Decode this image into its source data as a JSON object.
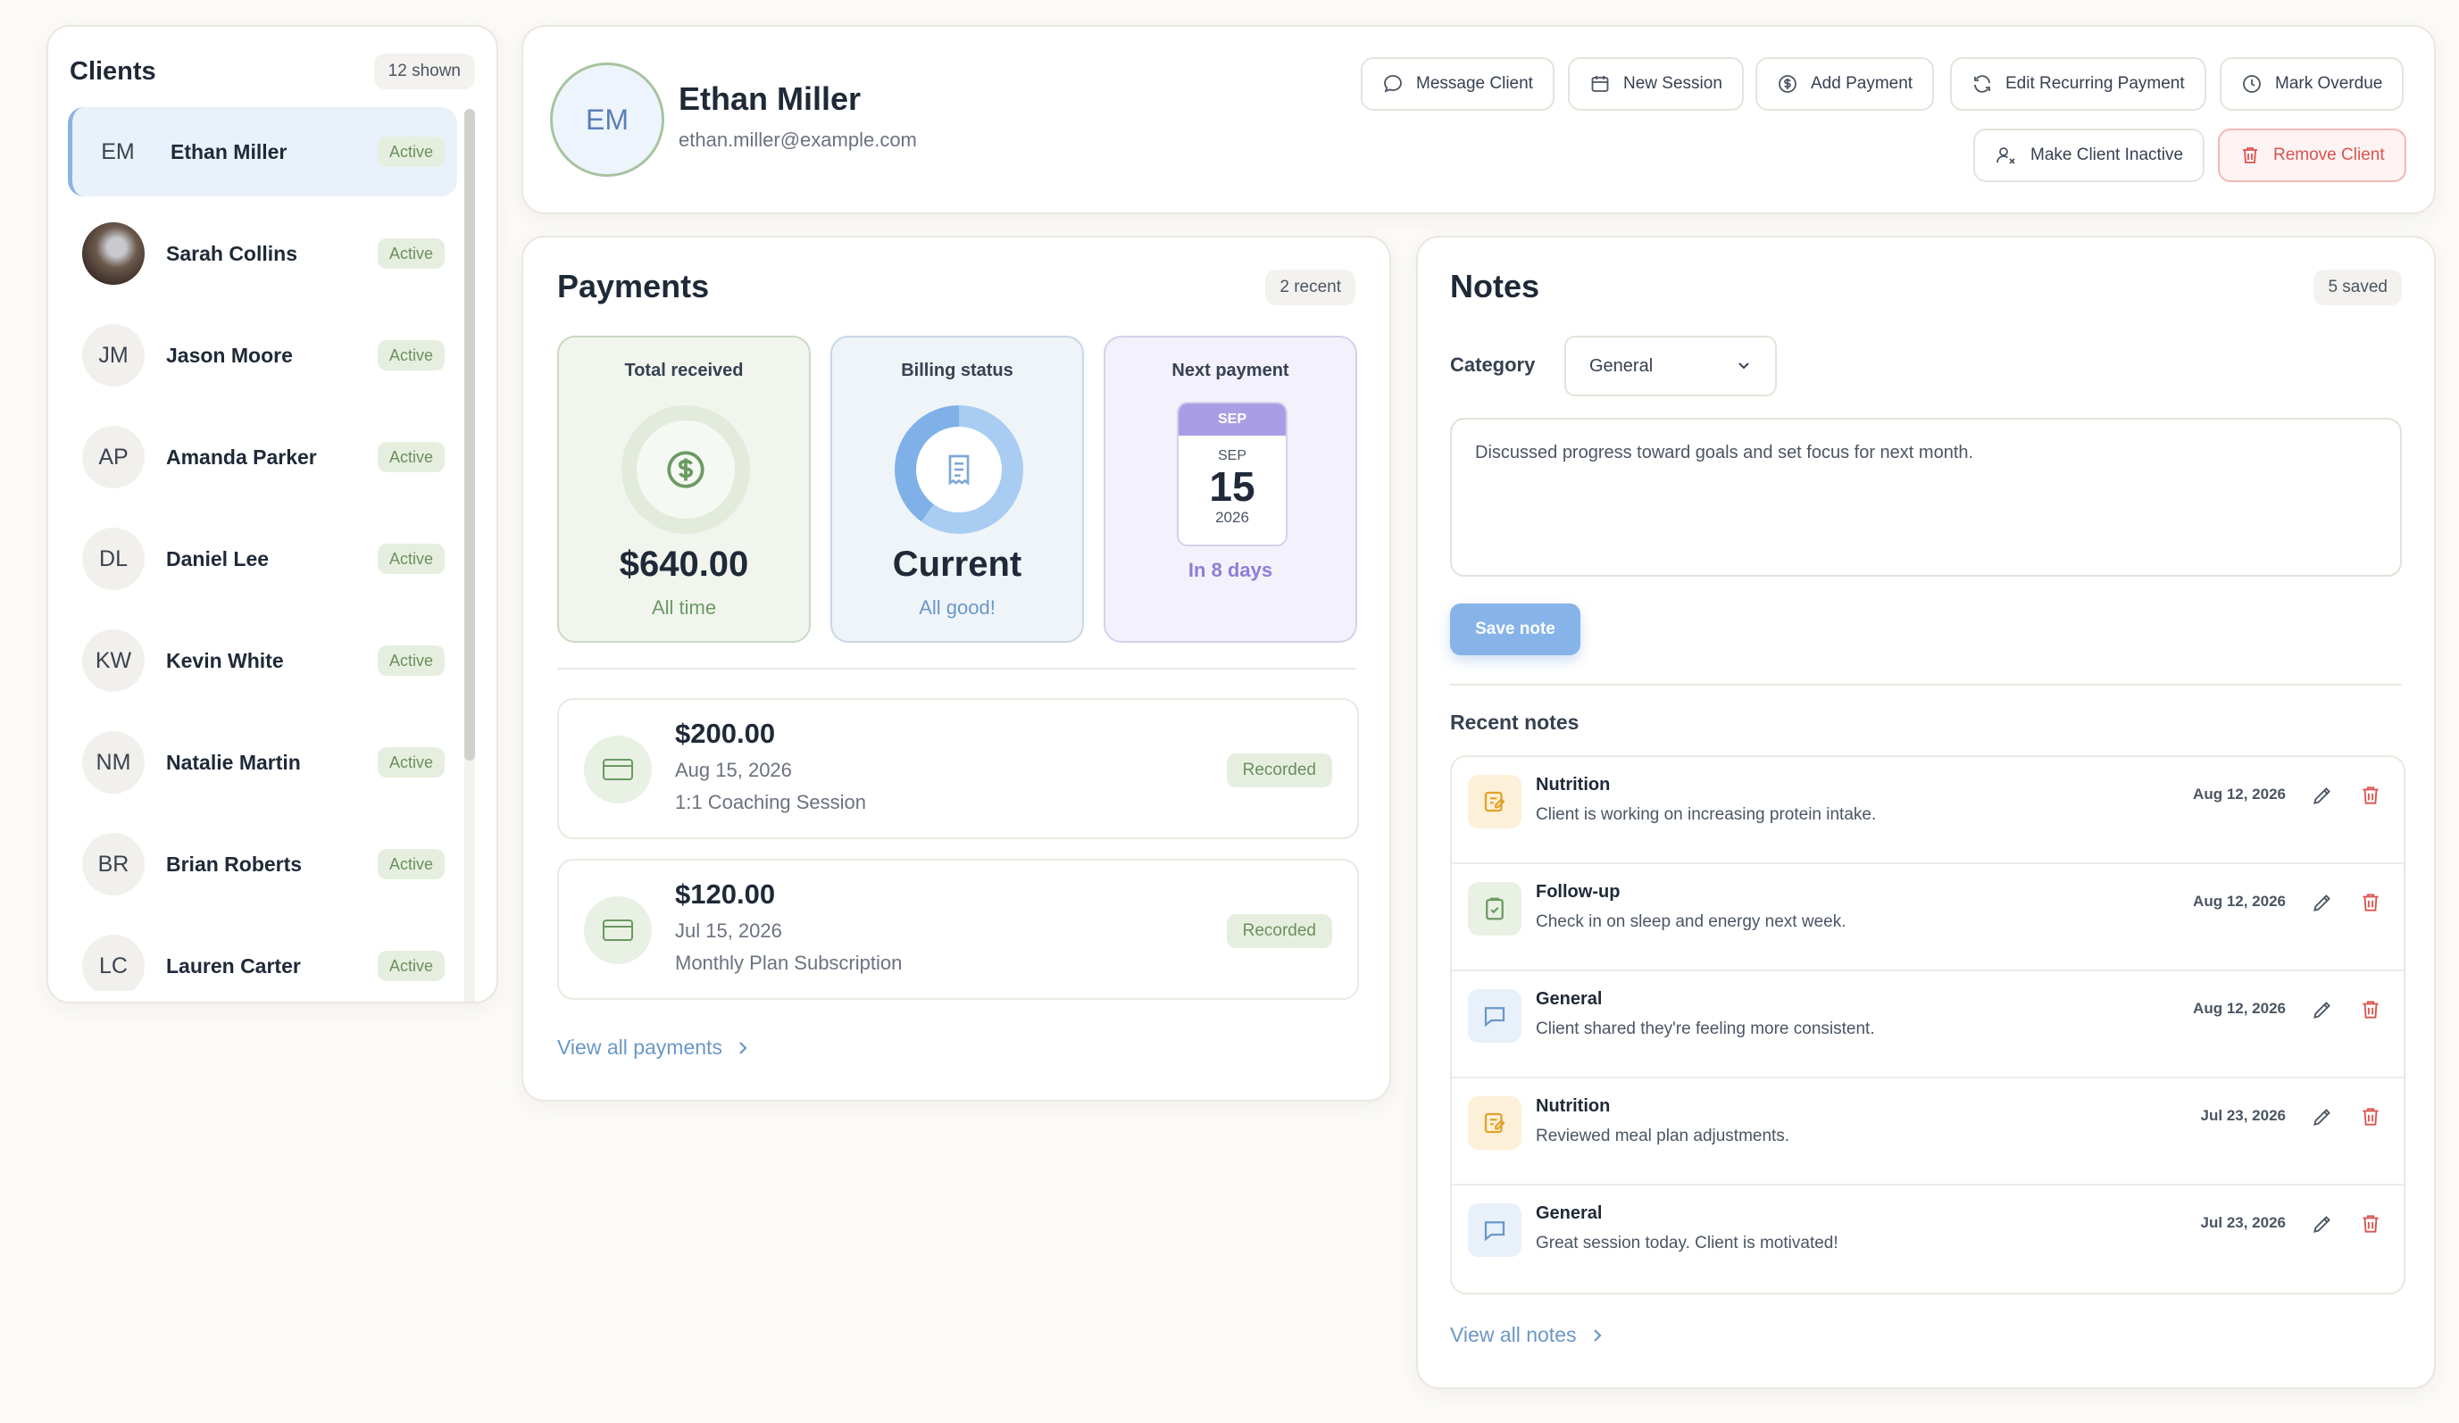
{
  "clients": {
    "title": "Clients",
    "count": "12 shown",
    "items": [
      {
        "initials": "EM",
        "name": "Ethan Miller",
        "status": "Active",
        "selected": true,
        "photo": false
      },
      {
        "initials": "",
        "name": "Sarah Collins",
        "status": "Active",
        "selected": false,
        "photo": true
      },
      {
        "initials": "JM",
        "name": "Jason Moore",
        "status": "Active",
        "selected": false,
        "photo": false
      },
      {
        "initials": "AP",
        "name": "Amanda Parker",
        "status": "Active",
        "selected": false,
        "photo": false
      },
      {
        "initials": "DL",
        "name": "Daniel Lee",
        "status": "Active",
        "selected": false,
        "photo": false
      },
      {
        "initials": "KW",
        "name": "Kevin White",
        "status": "Active",
        "selected": false,
        "photo": false
      },
      {
        "initials": "NM",
        "name": "Natalie Martin",
        "status": "Active",
        "selected": false,
        "photo": false
      },
      {
        "initials": "BR",
        "name": "Brian Roberts",
        "status": "Active",
        "selected": false,
        "photo": false
      },
      {
        "initials": "LC",
        "name": "Lauren Carter",
        "status": "Active",
        "selected": false,
        "photo": false
      }
    ]
  },
  "profile": {
    "initials": "EM",
    "name": "Ethan Miller",
    "email": "ethan.miller@example.com",
    "actions": {
      "message": "Message Client",
      "new_session": "New Session",
      "add_payment": "Add Payment",
      "edit_recurring": "Edit Recurring Payment",
      "mark_overdue": "Mark Overdue",
      "make_inactive": "Make Client Inactive",
      "remove": "Remove Client"
    }
  },
  "payments": {
    "title": "Payments",
    "count": "2 recent",
    "total": {
      "label": "Total received",
      "value": "$640.00",
      "sub": "All time"
    },
    "billing": {
      "label": "Billing status",
      "value": "Current",
      "sub": "All good!"
    },
    "next": {
      "label": "Next payment",
      "month_header": "SEP",
      "month": "SEP",
      "day": "15",
      "year": "2026",
      "sub": "In 8 days"
    },
    "items": [
      {
        "amount": "$200.00",
        "date": "Aug 15, 2026",
        "description": "1:1 Coaching Session",
        "status": "Recorded"
      },
      {
        "amount": "$120.00",
        "date": "Jul 15, 2026",
        "description": "Monthly Plan Subscription",
        "status": "Recorded"
      }
    ],
    "view_all": "View all payments"
  },
  "notes": {
    "title": "Notes",
    "count": "5 saved",
    "category_label": "Category",
    "category_value": "General",
    "draft": "Discussed progress toward goals and set focus for next month.",
    "save_label": "Save note",
    "recent_label": "Recent notes",
    "items": [
      {
        "category": "Nutrition",
        "text": "Client is working on increasing protein intake.",
        "date": "Aug 12, 2026",
        "icon": "nutrition-icon"
      },
      {
        "category": "Follow-up",
        "text": "Check in on sleep and energy next week.",
        "date": "Aug 12, 2026",
        "icon": "clipboard-check-icon"
      },
      {
        "category": "General",
        "text": "Client shared they're feeling more consistent.",
        "date": "Aug 12, 2026",
        "icon": "chat-bubble-icon"
      },
      {
        "category": "Nutrition",
        "text": "Reviewed meal plan adjustments.",
        "date": "Jul 23, 2026",
        "icon": "nutrition-icon"
      },
      {
        "category": "General",
        "text": "Great session today. Client is motivated!",
        "date": "Jul 23, 2026",
        "icon": "chat-bubble-icon"
      }
    ],
    "view_all": "View all notes"
  },
  "colors": {
    "accent_blue": "#86b4e8",
    "green_chip_bg": "#e6efdf",
    "green_text": "#6b8f5e",
    "danger": "#d9534f",
    "purple": "#8a7fd6"
  }
}
